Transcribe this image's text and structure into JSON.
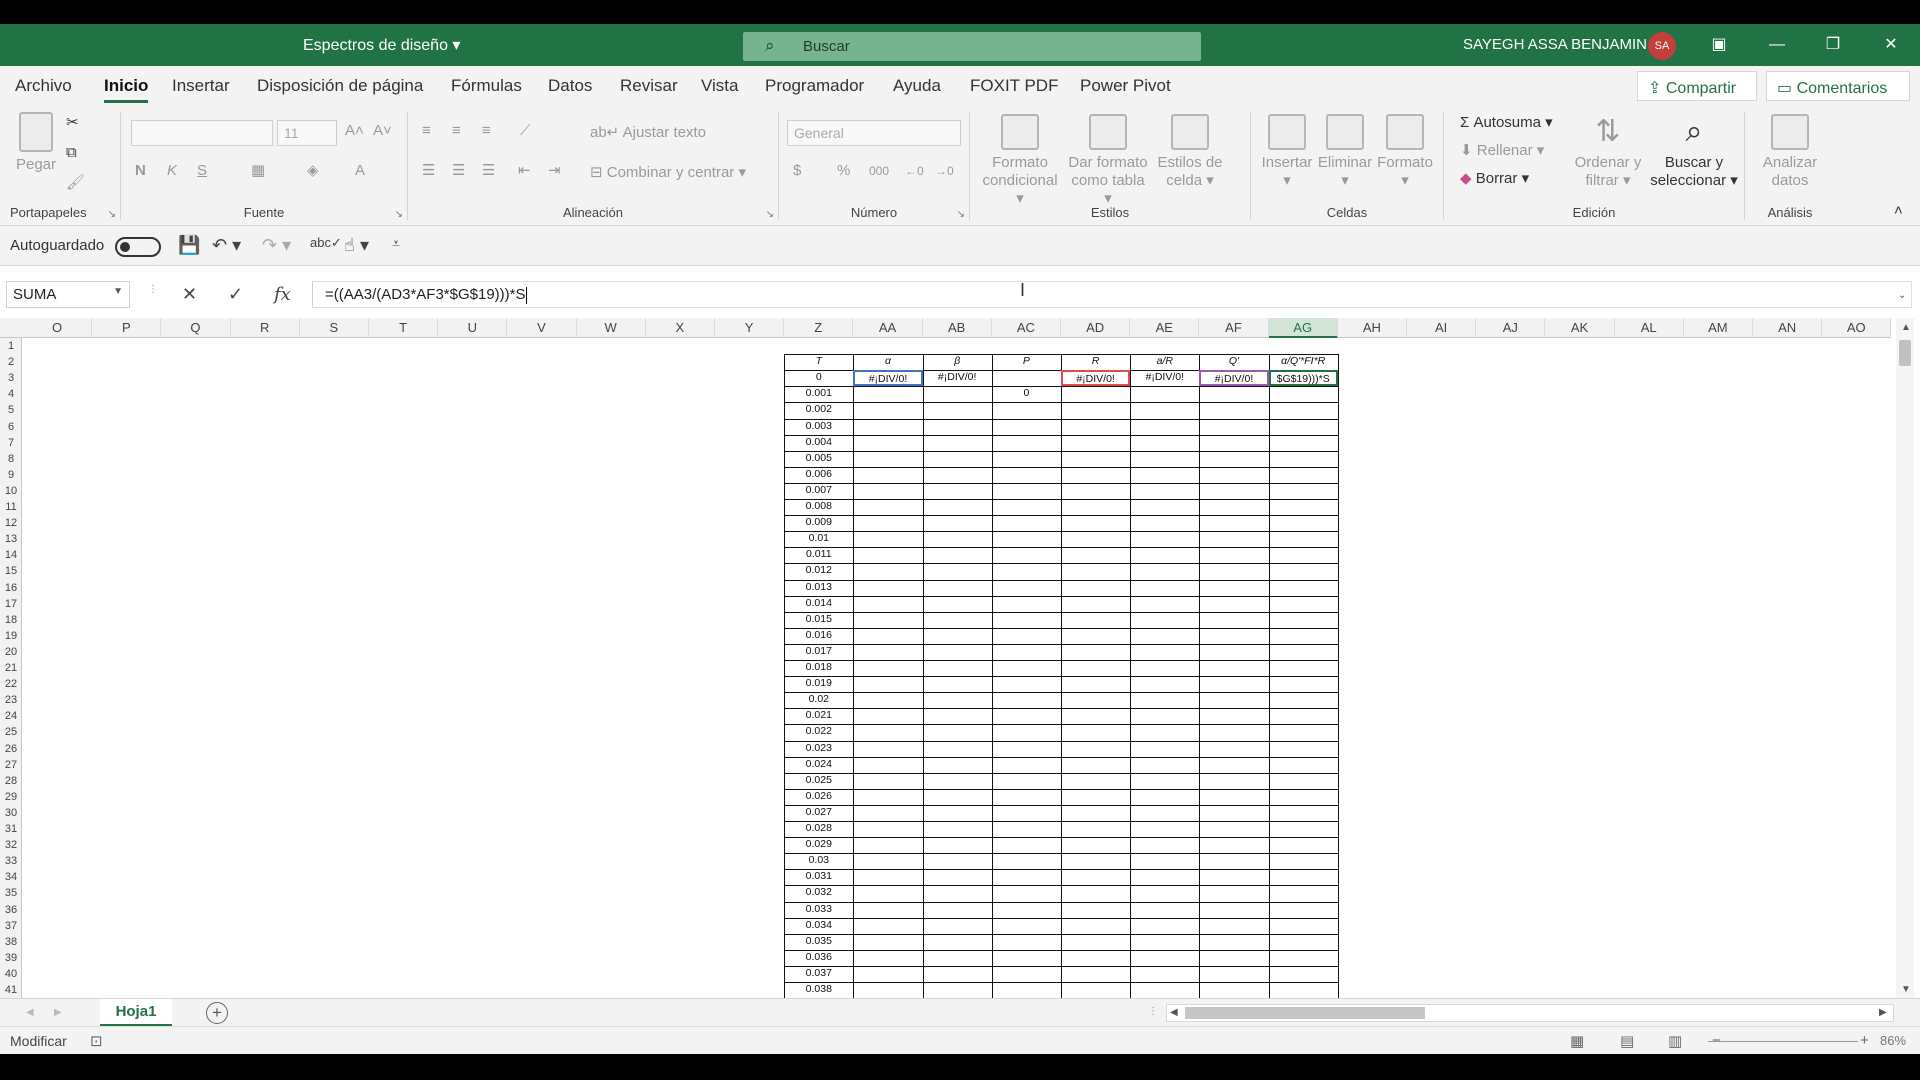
{
  "titlebar": {
    "document": "Espectros de diseño",
    "search_placeholder": "Buscar",
    "user_name": "SAYEGH ASSA BENJAMIN",
    "user_initials": "SA"
  },
  "menu": {
    "tabs": [
      "Archivo",
      "Inicio",
      "Insertar",
      "Disposición de página",
      "Fórmulas",
      "Datos",
      "Revisar",
      "Vista",
      "Programador",
      "Ayuda",
      "FOXIT PDF",
      "Power Pivot"
    ],
    "active": "Inicio",
    "share": "Compartir",
    "comments": "Comentarios"
  },
  "ribbon": {
    "portapapeles": {
      "label": "Portapapeles",
      "paste": "Pegar"
    },
    "fuente": {
      "label": "Fuente",
      "font_size": "11",
      "bold": "N",
      "italic": "K",
      "underline": "S"
    },
    "alineacion": {
      "label": "Alineación",
      "wrap": "Ajustar texto",
      "merge": "Combinar y centrar"
    },
    "numero": {
      "label": "Número",
      "format": "General"
    },
    "estilos": {
      "label": "Estilos",
      "cond_1": "Formato",
      "cond_2": "condicional",
      "table_1": "Dar formato",
      "table_2": "como tabla",
      "cell_1": "Estilos de",
      "cell_2": "celda"
    },
    "celdas": {
      "label": "Celdas",
      "insert": "Insertar",
      "delete": "Eliminar",
      "format": "Formato"
    },
    "edicion": {
      "label": "Edición",
      "autosum": "Autosuma",
      "fill": "Rellenar",
      "clear": "Borrar",
      "sort_1": "Ordenar y",
      "sort_2": "filtrar",
      "find_1": "Buscar y",
      "find_2": "seleccionar"
    },
    "analisis": {
      "label": "Análisis",
      "analyze_1": "Analizar",
      "analyze_2": "datos"
    }
  },
  "qat": {
    "autosave": "Autoguardado"
  },
  "formula_bar": {
    "name_box": "SUMA",
    "formula": "=((AA3/(AD3*AF3*$G$19)))*S"
  },
  "columns": [
    "O",
    "P",
    "Q",
    "R",
    "S",
    "T",
    "U",
    "V",
    "W",
    "X",
    "Y",
    "Z",
    "AA",
    "AB",
    "AC",
    "AD",
    "AE",
    "AF",
    "AG",
    "AH",
    "AI",
    "AJ",
    "AK",
    "AL",
    "AM",
    "AN",
    "AO"
  ],
  "selected_column": "AG",
  "rows": [
    "1",
    "2",
    "3",
    "4",
    "5",
    "6",
    "7",
    "8",
    "9",
    "10",
    "11",
    "12",
    "13",
    "14",
    "15",
    "16",
    "17",
    "18",
    "19",
    "20",
    "21",
    "22",
    "23",
    "24",
    "25",
    "26",
    "27",
    "28",
    "29",
    "30",
    "31",
    "32",
    "33",
    "34",
    "35",
    "36",
    "37",
    "38",
    "39",
    "40",
    "41"
  ],
  "table": {
    "headers": [
      "T",
      "α",
      "β",
      "P",
      "R",
      "a/R",
      "Q'",
      "α/Q'*FI*R"
    ],
    "row3": [
      "0",
      "#¡DIV/0!",
      "#¡DIV/0!",
      "",
      "#¡DIV/0!",
      "#¡DIV/0!",
      "#¡DIV/0!",
      "$G$19)))*S"
    ],
    "ac4": "0",
    "t_values": [
      "0.001",
      "0.002",
      "0.003",
      "0.004",
      "0.005",
      "0.006",
      "0.007",
      "0.008",
      "0.009",
      "0.01",
      "0.011",
      "0.012",
      "0.013",
      "0.014",
      "0.015",
      "0.016",
      "0.017",
      "0.018",
      "0.019",
      "0.02",
      "0.021",
      "0.022",
      "0.023",
      "0.024",
      "0.025",
      "0.026",
      "0.027",
      "0.028",
      "0.029",
      "0.03",
      "0.031",
      "0.032",
      "0.033",
      "0.034",
      "0.035",
      "0.036",
      "0.037",
      "0.038"
    ]
  },
  "sheet": {
    "tab": "Hoja1"
  },
  "status": {
    "mode": "Modificar",
    "zoom": "86%"
  },
  "colors": {
    "accent": "#217346",
    "error_blue": "#4472c4",
    "error_red": "#e34a4a",
    "error_purple": "#9b59b6"
  }
}
